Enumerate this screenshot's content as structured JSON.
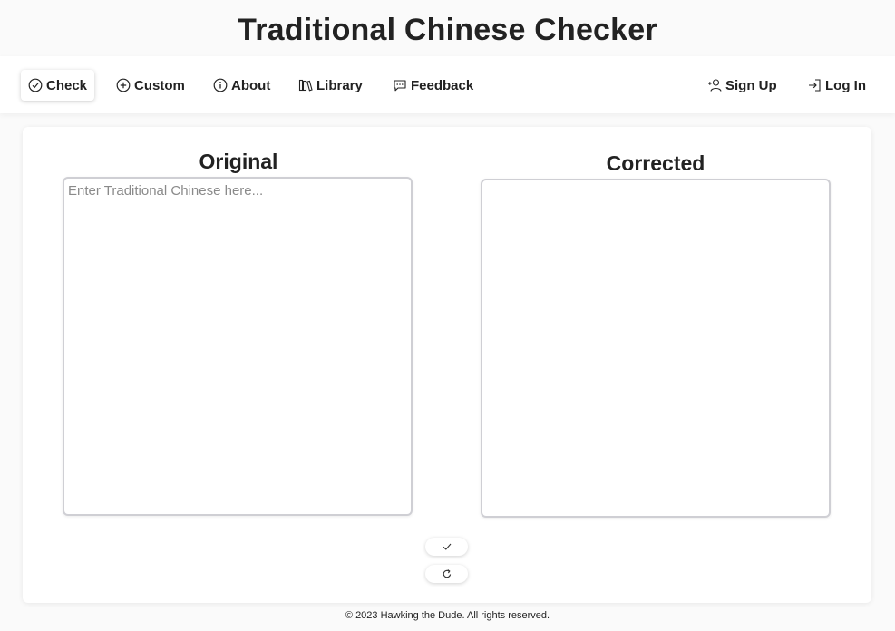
{
  "app": {
    "title": "Traditional Chinese Checker"
  },
  "nav": {
    "left": [
      {
        "label": "Check",
        "icon": "check-circle-icon",
        "active": true
      },
      {
        "label": "Custom",
        "icon": "plus-circle-icon",
        "active": false
      },
      {
        "label": "About",
        "icon": "info-circle-icon",
        "active": false
      },
      {
        "label": "Library",
        "icon": "library-icon",
        "active": false
      },
      {
        "label": "Feedback",
        "icon": "chat-bubble-icon",
        "active": false
      }
    ],
    "right": [
      {
        "label": "Sign Up",
        "icon": "user-plus-icon"
      },
      {
        "label": "Log In",
        "icon": "login-icon"
      }
    ]
  },
  "editor": {
    "original_title": "Original",
    "original_placeholder": "Enter Traditional Chinese here...",
    "original_value": "",
    "corrected_title": "Corrected",
    "corrected_value": ""
  },
  "actions": {
    "check_icon": "checkmark-icon",
    "reset_icon": "refresh-icon"
  },
  "footer": {
    "text": "© 2023 Hawking the Dude. All rights reserved."
  },
  "colors": {
    "text": "#222222",
    "textarea_border": "#cfcfd4",
    "background": "#fafafa"
  }
}
